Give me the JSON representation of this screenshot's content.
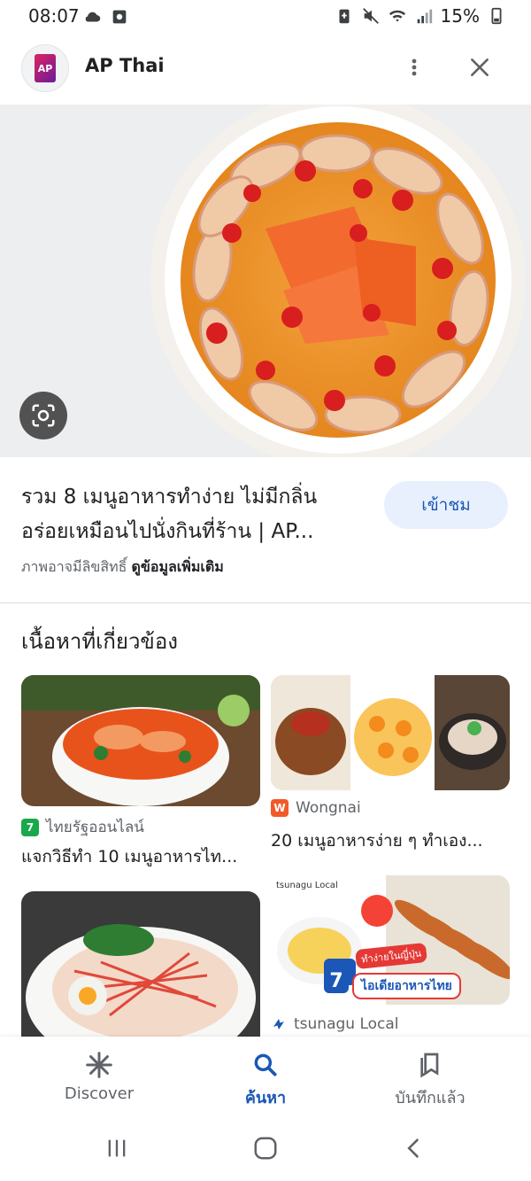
{
  "status_bar": {
    "time": "08:07",
    "battery": "15%",
    "left_icons": [
      "cloud-icon",
      "app-notification-icon"
    ],
    "right_icons": [
      "battery-saver-icon",
      "mute-icon",
      "wifi-icon",
      "signal-icon",
      "battery-icon"
    ]
  },
  "header": {
    "logo_text": "AP",
    "title": "AP Thai"
  },
  "result": {
    "title_line1": "รวม 8 เมนูอาหารทำง่าย ไม่มีกลิ่น",
    "title_line2": "อร่อยเหมือนไปนั่งกินที่ร้าน | AP...",
    "visit_label": "เข้าชม",
    "copyright_text": "ภาพอาจมีลิขสิทธิ์",
    "more_info_label": "ดูข้อมูลเพิ่มเติม"
  },
  "related": {
    "heading": "เนื้อหาที่เกี่ยวข้อง",
    "cards": [
      {
        "source": "ไทยรัฐออนไลน์",
        "title": "แจกวิธีทำ 10 เมนูอาหารไท...",
        "logo": "7",
        "logo_color": "#19a84a"
      },
      {
        "source": "Wongnai",
        "title": "20 เมนูอาหารง่าย ๆ ทำเอง...",
        "logo": "W",
        "logo_color": "#f05a28"
      },
      {
        "source": "",
        "title": "",
        "logo": "",
        "logo_color": ""
      },
      {
        "source": "tsunagu Local",
        "title": "",
        "logo": "",
        "logo_color": "#1a57b6"
      }
    ],
    "card4_image_brand": "tsunagu Local",
    "card4_overlay_small": "ทำง่ายในญี่ปุ่น",
    "card4_overlay_number": "7",
    "card4_overlay_big": "ไอเดียอาหารไทย"
  },
  "bottom_nav": {
    "items": [
      {
        "label": "Discover",
        "icon": "asterisk-icon"
      },
      {
        "label": "ค้นหา",
        "icon": "search-icon"
      },
      {
        "label": "บันทึกแล้ว",
        "icon": "bookmarks-icon"
      }
    ],
    "active_color": "#1a57b6"
  },
  "system_nav": [
    "recent-apps-icon",
    "home-icon",
    "back-icon"
  ]
}
